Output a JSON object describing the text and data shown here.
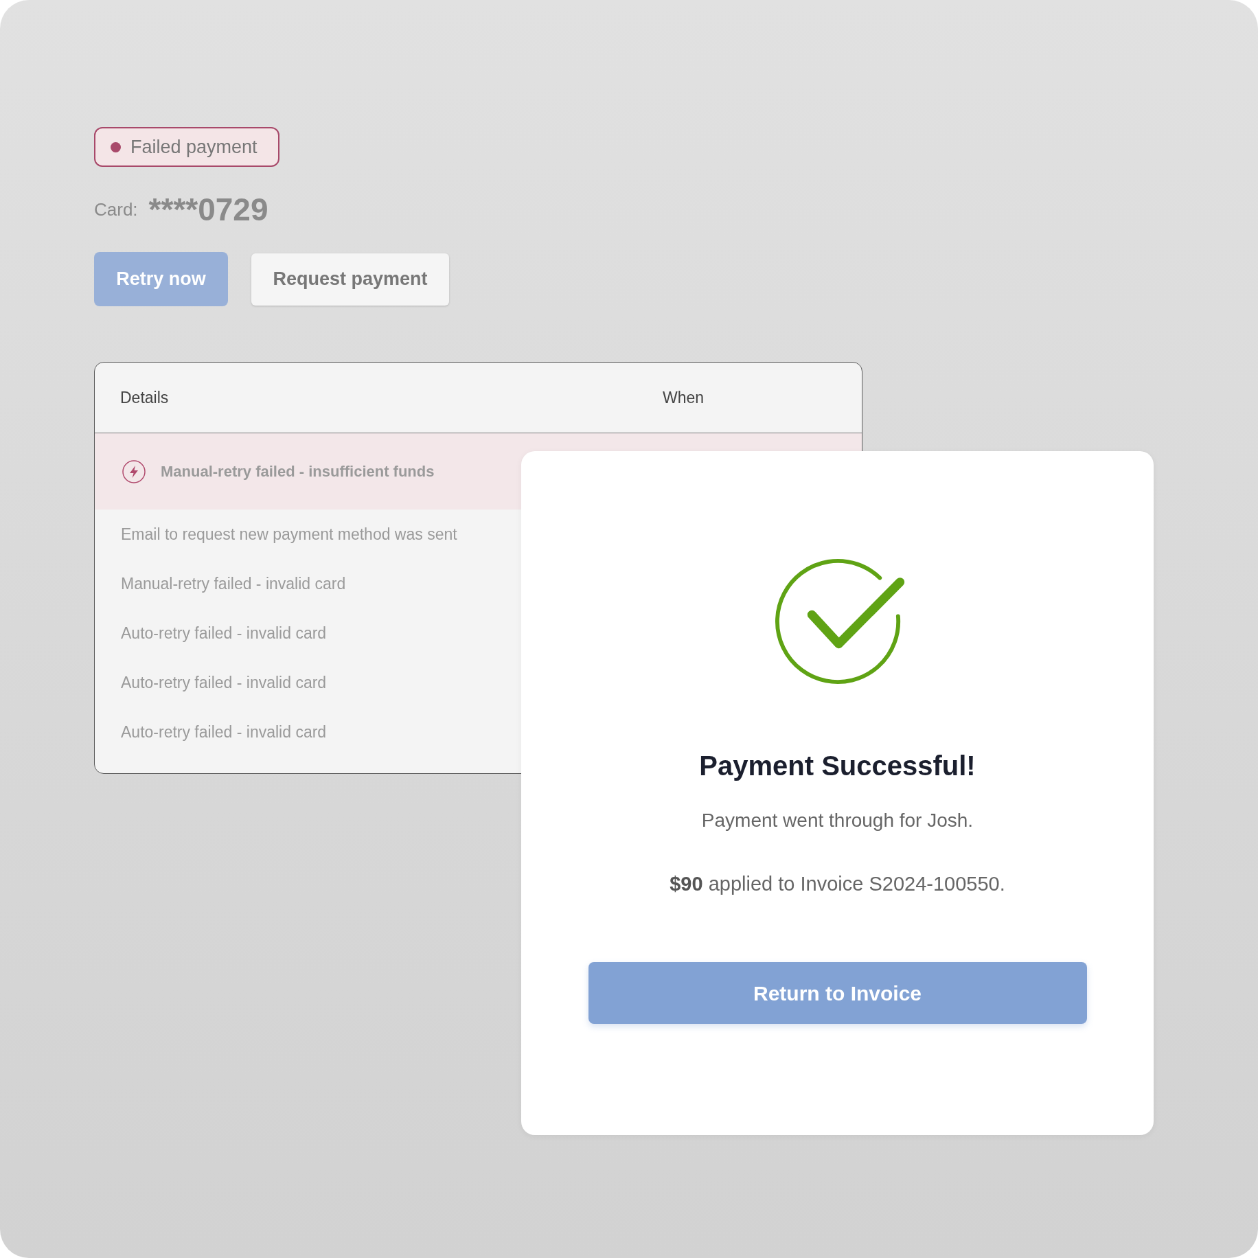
{
  "status_badge": {
    "label": "Failed payment"
  },
  "card": {
    "label": "Card:",
    "number": "****0729"
  },
  "actions": [
    {
      "label": "Retry now",
      "kind": "primary"
    },
    {
      "label": "Request payment",
      "kind": "secondary"
    }
  ],
  "table": {
    "columns": [
      "Details",
      "When"
    ],
    "rows": [
      {
        "details": "Manual-retry failed - insufficient funds",
        "highlighted": true
      },
      {
        "details": "Email to request new payment method was sent",
        "highlighted": false
      },
      {
        "details": "Manual-retry failed - invalid card",
        "highlighted": false
      },
      {
        "details": "Auto-retry failed - invalid card",
        "highlighted": false
      },
      {
        "details": "Auto-retry failed - invalid card",
        "highlighted": false
      },
      {
        "details": "Auto-retry failed - invalid card",
        "highlighted": false
      }
    ]
  },
  "dialog": {
    "title": "Payment Successful!",
    "message": "Payment went through for Josh.",
    "summary": "**$90** applied to Invoice S2024-100550.",
    "button": "Return to Invoice"
  }
}
